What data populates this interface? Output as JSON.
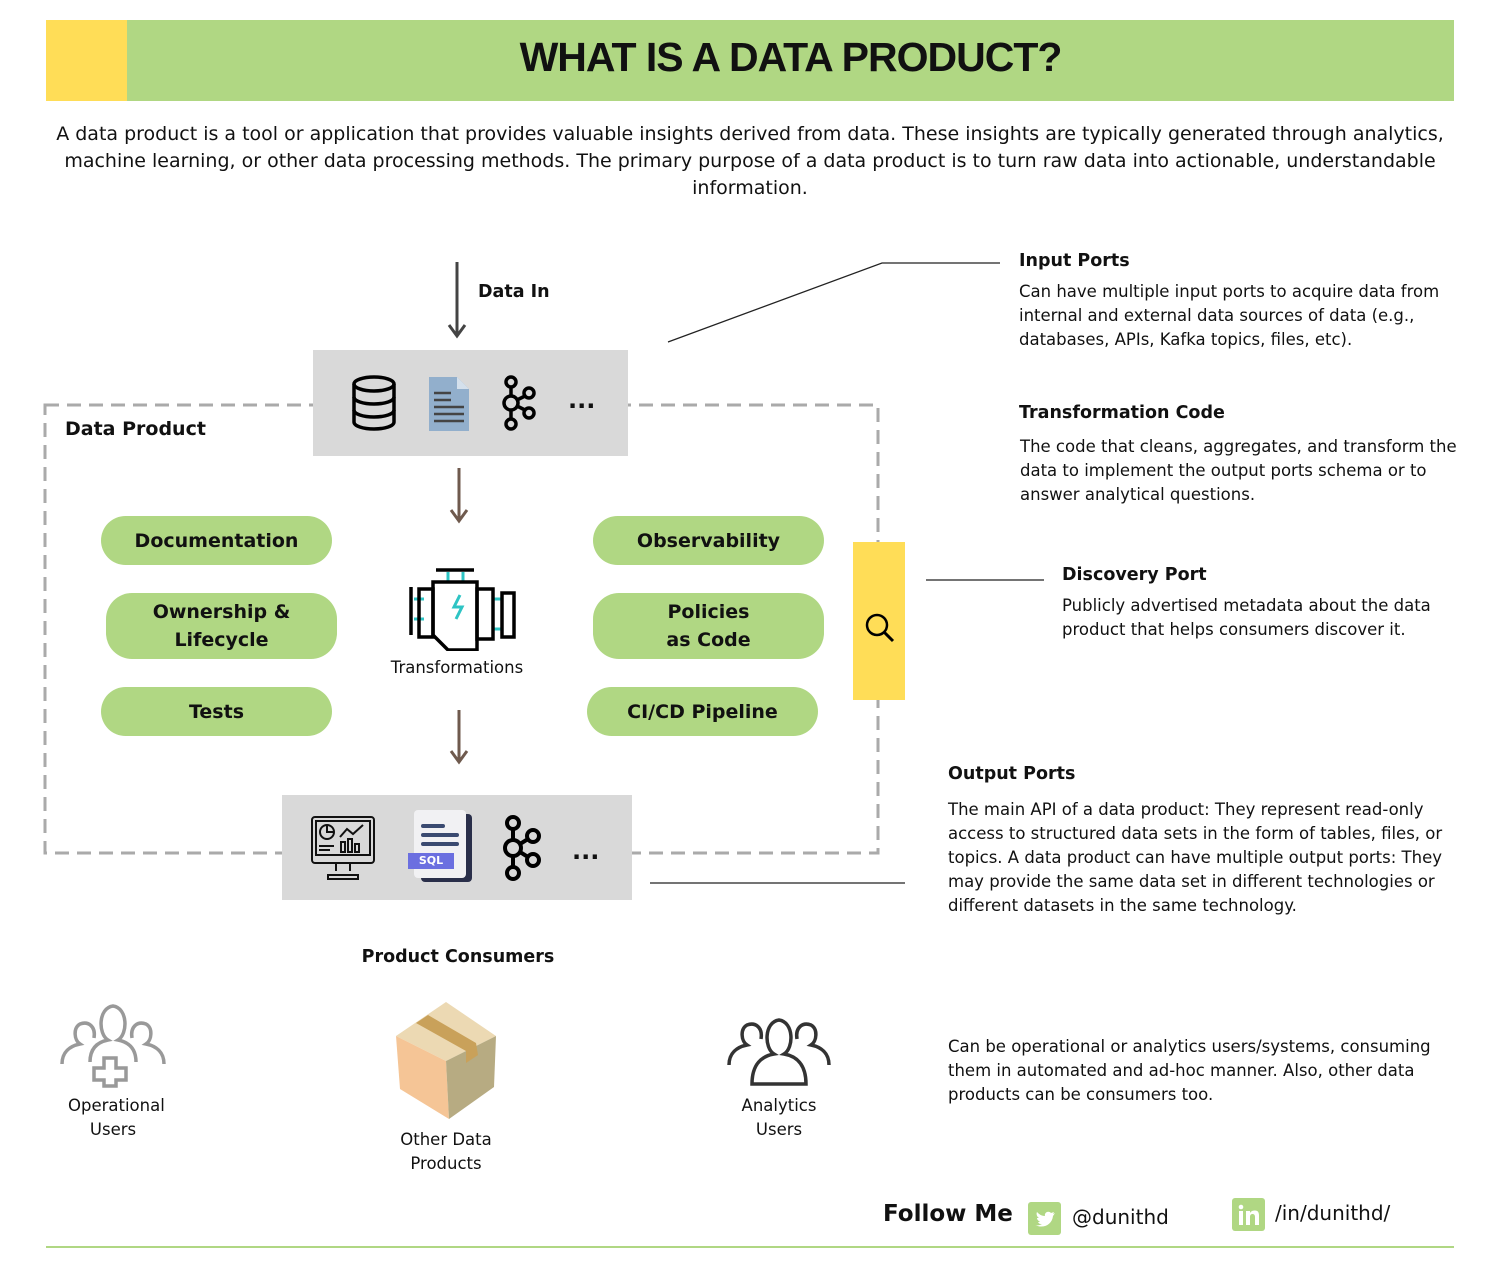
{
  "header": {
    "title": "WHAT IS A DATA PRODUCT?"
  },
  "intro": "A data product is a tool or application that provides valuable insights derived from data. These insights are typically generated through analytics, machine learning, or other data processing methods. The primary purpose of a data product is to turn raw data into actionable, understandable information.",
  "diagram": {
    "data_in": "Data In",
    "data_product_label": "Data Product",
    "input_more": "...",
    "output_more": "...",
    "sql_badge": "SQL",
    "transformations": "Transformations",
    "pills": {
      "documentation": "Documentation",
      "ownership": "Ownership & Lifecycle",
      "tests": "Tests",
      "observability": "Observability",
      "policies": "Policies as Code",
      "cicd": "CI/CD Pipeline"
    },
    "product_consumers": "Product Consumers",
    "consumers": [
      {
        "label": "Operational Users"
      },
      {
        "label": "Other Data Products"
      },
      {
        "label": "Analytics Users"
      }
    ]
  },
  "notes": {
    "input_ports": {
      "title": "Input Ports",
      "body": "Can have multiple input ports to acquire data from internal and external data sources of data (e.g., databases, APIs, Kafka topics, files, etc)."
    },
    "transformation_code": {
      "title": "Transformation Code",
      "body": "The code that cleans, aggregates, and transform the data to implement the output ports schema or to answer analytical questions."
    },
    "discovery_port": {
      "title": "Discovery Port",
      "body": "Publicly advertised metadata about the data product that helps consumers discover it."
    },
    "output_ports": {
      "title": "Output Ports",
      "body": "The main API of a data product: They represent read-only access to structured data sets in the form of tables, files, or topics. A data product can have multiple output ports: They may provide the same data set in different technologies or different datasets in the same technology."
    },
    "consumers": {
      "body": "Can be operational or analytics users/systems, consuming them in automated and ad-hoc manner. Also, other data products can be consumers too."
    }
  },
  "footer": {
    "follow": "Follow Me",
    "twitter": "@dunithd",
    "linkedin": "/in/dunithd/"
  },
  "colors": {
    "green": "#b0d783",
    "yellow": "#ffdd57",
    "gray_box": "#d9d9d9",
    "arrow_brown": "#6f5a4e"
  }
}
